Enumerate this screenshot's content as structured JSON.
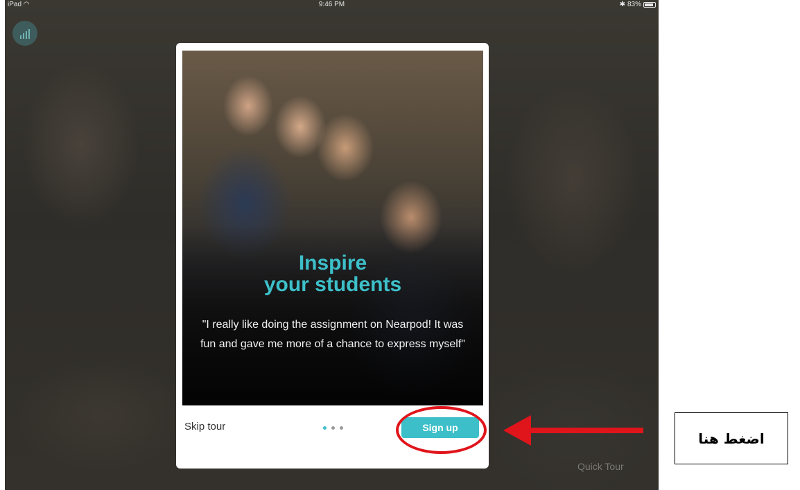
{
  "status_bar": {
    "device": "iPad",
    "time": "9:46 PM",
    "battery": "83%"
  },
  "background": {
    "quick_tour_label": "Quick Tour"
  },
  "card": {
    "title_line1": "Inspire",
    "title_line2": "your students",
    "quote": "\"I really like doing the assignment on Nearpod! It was fun and gave me more of a chance to express myself\"",
    "skip_label": "Skip tour",
    "signup_label": "Sign up",
    "pager": {
      "count": 3,
      "active_index": 0
    },
    "accent_color": "#3dc0c9"
  },
  "annotation": {
    "callout_text": "اضغط هنا",
    "color": "#e0141b"
  }
}
